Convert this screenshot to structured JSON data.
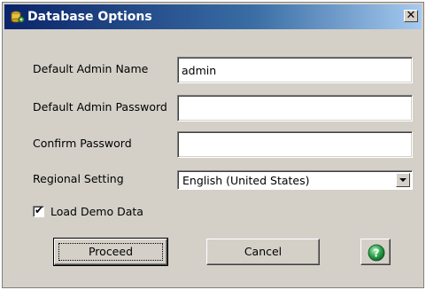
{
  "window": {
    "title": "Database Options",
    "close_glyph": "✕",
    "app_icon": "database-gear-icon"
  },
  "form": {
    "admin_name": {
      "label": "Default Admin Name",
      "value": "admin",
      "placeholder": ""
    },
    "admin_password": {
      "label": "Default Admin Password",
      "value": "",
      "placeholder": ""
    },
    "confirm_password": {
      "label": "Confirm Password",
      "value": "",
      "placeholder": ""
    },
    "regional_setting": {
      "label": "Regional Setting",
      "selected": "English (United States)"
    },
    "load_demo": {
      "label": "Load Demo Data",
      "checked": true,
      "mark": "✔"
    }
  },
  "buttons": {
    "proceed": "Proceed",
    "cancel": "Cancel",
    "help_icon": "help-icon"
  },
  "colors": {
    "dialog_bg": "#d4d0c8",
    "titlebar_start": "#0a246a",
    "titlebar_end": "#a6caf0",
    "help_green": "#2fa84f"
  }
}
